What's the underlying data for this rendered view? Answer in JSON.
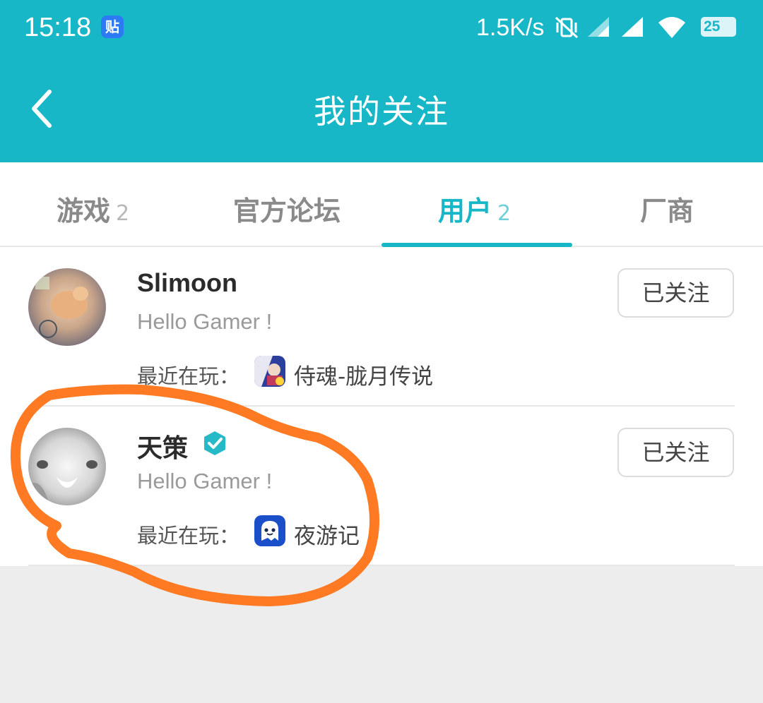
{
  "status_bar": {
    "time": "15:18",
    "app_badge": "贴",
    "net_speed": "1.5K/s",
    "battery": "25",
    "icons": [
      "vibrate-icon",
      "signal-icon",
      "signal-icon",
      "wifi-icon",
      "battery-icon"
    ]
  },
  "header": {
    "title": "我的关注",
    "back_icon": "chevron-left-icon"
  },
  "tabs": [
    {
      "label": "游戏",
      "count": "2",
      "active": false
    },
    {
      "label": "官方论坛",
      "count": "",
      "active": false
    },
    {
      "label": "用户",
      "count": "2",
      "active": true
    },
    {
      "label": "厂商",
      "count": "",
      "active": false
    }
  ],
  "users": [
    {
      "name": "Slimoon",
      "bio": "Hello Gamer !",
      "playing_label": "最近在玩：",
      "game": "侍魂-胧月传说",
      "follow_label": "已关注",
      "verified": false
    },
    {
      "name": "天策",
      "bio": "Hello Gamer !",
      "playing_label": "最近在玩：",
      "game": "夜游记",
      "follow_label": "已关注",
      "verified": true
    }
  ],
  "colors": {
    "accent": "#17b7c7",
    "annotation": "#ff7a22"
  }
}
